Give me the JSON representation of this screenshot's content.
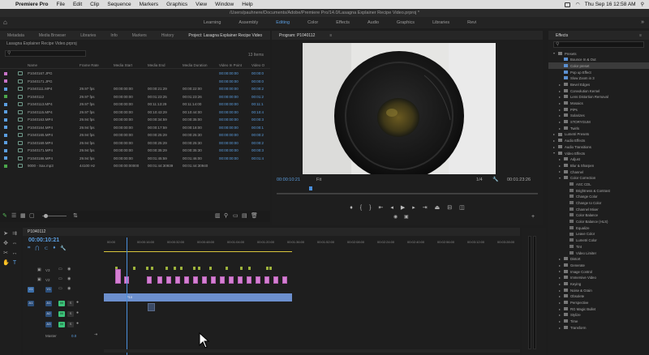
{
  "menubar": {
    "apple": "",
    "app": "Premiere Pro",
    "items": [
      "File",
      "Edit",
      "Clip",
      "Sequence",
      "Markers",
      "Graphics",
      "View",
      "Window",
      "Help"
    ],
    "clock": "Thu Sep 16 12:58 AM"
  },
  "titlebar": {
    "path": "/Users/pauhnere/Documents/Adobe/Premiere Pro/14.0/Lasagna Explainer Recipe Video.prproj *"
  },
  "workspaces": {
    "tabs": [
      "Learning",
      "Assembly",
      "Editing",
      "Color",
      "Effects",
      "Audio",
      "Graphics",
      "Libraries",
      "Revi"
    ],
    "active": "Editing"
  },
  "project_panel": {
    "tabs": [
      "Metadata",
      "Media Browser",
      "Libraries",
      "Info",
      "Markers",
      "History",
      "Project: Lasagna Explainer Recipe Video"
    ],
    "active_tab": "Project: Lasagna Explainer Recipe Video",
    "file": "Lasagna Explainer Recipe Video.prproj",
    "item_count": "13 Items",
    "columns": [
      "Name",
      "Frame Rate",
      "Media Start",
      "Media End",
      "Media Duration",
      "Video In Point",
      "Video O"
    ],
    "rows": [
      {
        "name": "P1040167.JPG",
        "fr": "",
        "start": "",
        "end": "",
        "dur": "",
        "vin": "00:00:00:00",
        "vout": "00:00:0",
        "color": "#c873c8"
      },
      {
        "name": "P1040171.JPG",
        "fr": "",
        "start": "",
        "end": "",
        "dur": "",
        "vin": "00:00:00:00",
        "vout": "00:00:0",
        "color": "#c873c8"
      },
      {
        "name": "P1040111.MP4",
        "fr": "29.97 fps",
        "start": "00:00:00:00",
        "end": "00:00:21:29",
        "dur": "00:00:22:00",
        "vin": "00:00:00:00",
        "vout": "00:00:2",
        "color": "#5b9ee0"
      },
      {
        "name": "P1040112",
        "fr": "29.97 fps",
        "start": "00:00:00:00",
        "end": "00:01:23:25",
        "dur": "00:01:23:26",
        "vin": "00:00:00:00",
        "vout": "00:01:2",
        "color": "#4ba64b"
      },
      {
        "name": "P1040113.MP4",
        "fr": "29.97 fps",
        "start": "00:00:00:00",
        "end": "00:11:13:29",
        "dur": "00:11:14:00",
        "vin": "00:00:00:00",
        "vout": "00:11:1",
        "color": "#5b9ee0"
      },
      {
        "name": "P1040115.MP4",
        "fr": "29.97 fps",
        "start": "00:00:00:00",
        "end": "00:10:43:29",
        "dur": "00:10:44:00",
        "vin": "00:00:00:00",
        "vout": "00:10:4",
        "color": "#5b9ee0"
      },
      {
        "name": "P1040163.MP4",
        "fr": "29.94 fps",
        "start": "00:00:00:00",
        "end": "00:00:34:59",
        "dur": "00:00:35:00",
        "vin": "00:00:00:00",
        "vout": "00:00:3",
        "color": "#5b9ee0"
      },
      {
        "name": "P1040164.MP4",
        "fr": "29.94 fps",
        "start": "00:00:00:00",
        "end": "00:00:17:59",
        "dur": "00:00:18:00",
        "vin": "00:00:00:00",
        "vout": "00:00:1",
        "color": "#5b9ee0"
      },
      {
        "name": "P1040165.MP4",
        "fr": "29.94 fps",
        "start": "00:00:00:00",
        "end": "00:00:25:29",
        "dur": "00:00:25:30",
        "vin": "00:00:00:00",
        "vout": "00:00:2",
        "color": "#5b9ee0"
      },
      {
        "name": "P1040169.MP4",
        "fr": "29.94 fps",
        "start": "00:00:00:00",
        "end": "00:00:25:29",
        "dur": "00:00:25:30",
        "vin": "00:00:00:00",
        "vout": "00:00:2",
        "color": "#5b9ee0"
      },
      {
        "name": "P1040171.MP4",
        "fr": "29.94 fps",
        "start": "00:00:00:00",
        "end": "00:00:35:29",
        "dur": "00:00:35:30",
        "vin": "00:00:00:00",
        "vout": "00:00:3",
        "color": "#5b9ee0"
      },
      {
        "name": "P1040186.MP4",
        "fr": "29.94 fps",
        "start": "00:00:00:00",
        "end": "00:01:45:59",
        "dur": "00:01:46:00",
        "vin": "00:00:00:00",
        "vout": "00:01:4",
        "color": "#5b9ee0"
      },
      {
        "name": "9000 - Sax.mp3",
        "fr": "44100 Hz",
        "start": "00:00:00:00000",
        "end": "00:01:44:30939",
        "dur": "00:01:44:30940",
        "vin": "",
        "vout": "",
        "color": "#4ba64b"
      }
    ]
  },
  "program_monitor": {
    "title": "Program: P1040112",
    "timecode": "00:00:10:21",
    "fit": "Fit",
    "quality": "1/4",
    "duration": "00:01:23:26"
  },
  "effects_panel": {
    "title": "Effects",
    "tree": [
      {
        "label": "Presets",
        "level": 0,
        "open": true,
        "icon": "folder"
      },
      {
        "label": "Bounce In & Out",
        "level": 1,
        "icon": "preset"
      },
      {
        "label": "Color preset",
        "level": 1,
        "icon": "preset",
        "selected": true
      },
      {
        "label": "Pop up Effect",
        "level": 1,
        "icon": "preset"
      },
      {
        "label": "Slow Zoom in 3",
        "level": 1,
        "icon": "preset"
      },
      {
        "label": "Bevel Edges",
        "level": 1,
        "icon": "folder"
      },
      {
        "label": "Convolution Kernel",
        "level": 1,
        "icon": "folder"
      },
      {
        "label": "Lens Distortion Removal",
        "level": 1,
        "icon": "folder"
      },
      {
        "label": "Mosaics",
        "level": 1,
        "icon": "folder"
      },
      {
        "label": "PiPs",
        "level": 1,
        "icon": "folder"
      },
      {
        "label": "Solarizes",
        "level": 1,
        "icon": "folder"
      },
      {
        "label": "STORYGUM",
        "level": 1,
        "icon": "folder"
      },
      {
        "label": "Twirls",
        "level": 1,
        "icon": "folder"
      },
      {
        "label": "Lumetri Presets",
        "level": 0,
        "icon": "folder"
      },
      {
        "label": "Audio Effects",
        "level": 0,
        "icon": "folder"
      },
      {
        "label": "Audio Transitions",
        "level": 0,
        "icon": "folder"
      },
      {
        "label": "Video Effects",
        "level": 0,
        "open": true,
        "icon": "folder"
      },
      {
        "label": "Adjust",
        "level": 1,
        "icon": "folder"
      },
      {
        "label": "Blur & Sharpen",
        "level": 1,
        "icon": "folder"
      },
      {
        "label": "Channel",
        "level": 1,
        "icon": "folder"
      },
      {
        "label": "Color Correction",
        "level": 1,
        "open": true,
        "icon": "folder"
      },
      {
        "label": "ASC CDL",
        "level": 2,
        "icon": "fx"
      },
      {
        "label": "Brightness & Contrast",
        "level": 2,
        "icon": "fx"
      },
      {
        "label": "Change Color",
        "level": 2,
        "icon": "fx"
      },
      {
        "label": "Change to Color",
        "level": 2,
        "icon": "fx"
      },
      {
        "label": "Channel Mixer",
        "level": 2,
        "icon": "fx"
      },
      {
        "label": "Color Balance",
        "level": 2,
        "icon": "fx"
      },
      {
        "label": "Color Balance (HLS)",
        "level": 2,
        "icon": "fx"
      },
      {
        "label": "Equalize",
        "level": 2,
        "icon": "fx"
      },
      {
        "label": "Leave Color",
        "level": 2,
        "icon": "fx"
      },
      {
        "label": "Lumetri Color",
        "level": 2,
        "icon": "fx"
      },
      {
        "label": "Tint",
        "level": 2,
        "icon": "fx"
      },
      {
        "label": "Video Limiter",
        "level": 2,
        "icon": "fx"
      },
      {
        "label": "Distort",
        "level": 1,
        "icon": "folder"
      },
      {
        "label": "Generate",
        "level": 1,
        "icon": "folder"
      },
      {
        "label": "Image Control",
        "level": 1,
        "icon": "folder"
      },
      {
        "label": "Immersive Video",
        "level": 1,
        "icon": "folder"
      },
      {
        "label": "Keying",
        "level": 1,
        "icon": "folder"
      },
      {
        "label": "Noise & Grain",
        "level": 1,
        "icon": "folder"
      },
      {
        "label": "Obsolete",
        "level": 1,
        "icon": "folder"
      },
      {
        "label": "Perspective",
        "level": 1,
        "icon": "folder"
      },
      {
        "label": "RG Magic Bullet",
        "level": 1,
        "icon": "folder"
      },
      {
        "label": "Stylize",
        "level": 1,
        "icon": "folder"
      },
      {
        "label": "Time",
        "level": 1,
        "icon": "folder"
      },
      {
        "label": "Transform",
        "level": 1,
        "icon": "folder"
      }
    ]
  },
  "timeline": {
    "sequence": "P1040112",
    "timecode": "00:00:10:21",
    "ticks": [
      "00:00",
      "00:00:16:00",
      "00:00:32:00",
      "00:00:48:00",
      "00:01:04:00",
      "00:01:20:00",
      "00:01:36:00",
      "00:01:52:00",
      "00:02:08:00",
      "00:02:24:00",
      "00:02:40:00",
      "00:02:56:00",
      "00:03:12:00",
      "00:03:28:00"
    ],
    "tracks_video": [
      "V3",
      "V2",
      "V1"
    ],
    "tracks_audio": [
      "A1",
      "A2",
      "A3"
    ],
    "master_label": "Master",
    "master_value": "0.0",
    "clip_label": "P10",
    "src_v": "V1",
    "src_a": "A1"
  },
  "colors": {
    "accent": "#5b9ee0",
    "panel": "#1e1e1e",
    "clip_video": "#d57fd3",
    "clip_linked": "#6c8fcd",
    "audio_on": "#3cc47a"
  }
}
